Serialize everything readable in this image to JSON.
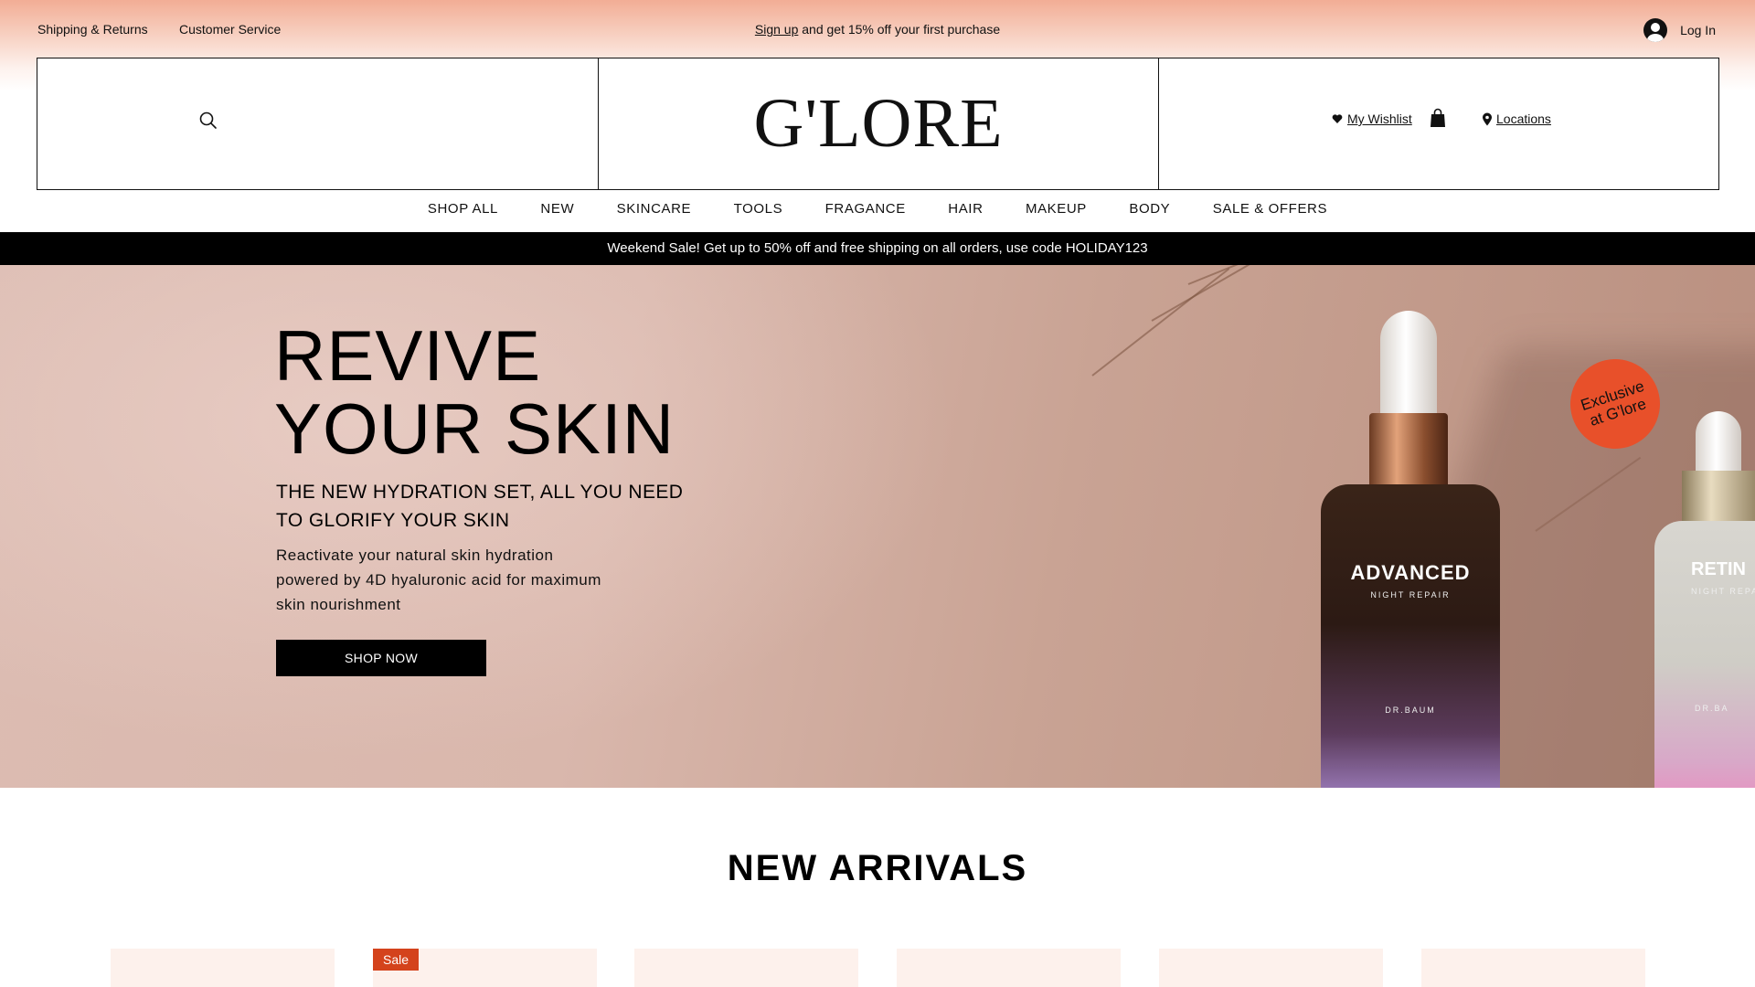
{
  "topbar": {
    "shipping_link": "Shipping & Returns",
    "service_link": "Customer Service",
    "promo_link": "Sign up",
    "promo_text": " and get 15% off your first purchase",
    "login_label": "Log In"
  },
  "header": {
    "logo": "G'LORE",
    "wishlist_label": "My Wishlist",
    "locations_label": "Locations"
  },
  "nav": {
    "items": [
      "SHOP ALL",
      "NEW",
      "SKINCARE",
      "TOOLS",
      "FRAGANCE",
      "HAIR",
      "MAKEUP",
      "BODY",
      "SALE & OFFERS"
    ]
  },
  "announcement": "Weekend Sale! Get up to 50% off and free shipping on all orders, use code HOLIDAY123",
  "hero": {
    "title_line1": "REVIVE",
    "title_line2": "YOUR SKIN",
    "subtitle": "THE NEW HYDRATION SET, ALL YOU NEED TO GLORIFY YOUR SKIN",
    "body": "Reactivate your natural skin hydration powered by 4D hyaluronic acid for maximum skin nourishment",
    "cta": "SHOP NOW",
    "badge_line1": "Exclusive",
    "badge_line2": "at G'lore",
    "bottle1_label": "ADVANCED",
    "bottle1_sub": "NIGHT REPAIR",
    "bottle1_brand": "DR.BAUM",
    "bottle2_label": "RETIN",
    "bottle2_sub": "NIGHT REPA",
    "bottle2_brand": "DR.BA"
  },
  "new_arrivals": {
    "title": "NEW ARRIVALS",
    "sale_badge": "Sale"
  },
  "colors": {
    "accent": "#e8502a",
    "sale": "#d4431c",
    "topbar_peach": "#f2ad95",
    "hero_bg": "#d9b7ac"
  },
  "icons": [
    "search-icon",
    "heart-icon",
    "shopping-bag-icon",
    "location-pin-icon",
    "user-avatar-icon"
  ]
}
